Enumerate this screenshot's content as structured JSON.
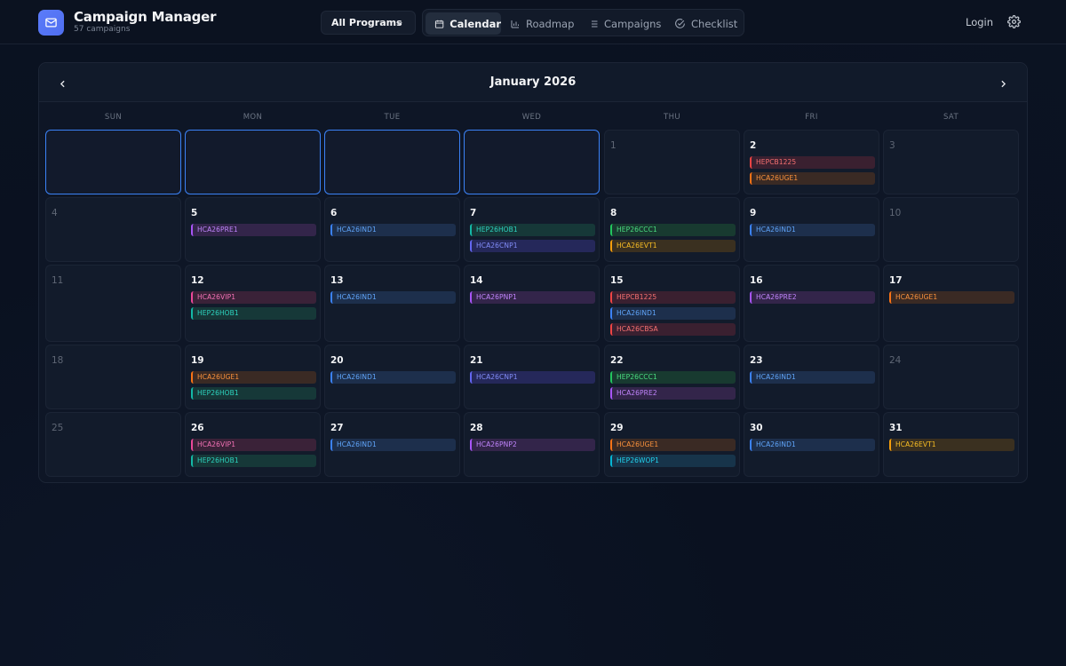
{
  "app": {
    "title": "Campaign Manager",
    "subtitle": "57 campaigns"
  },
  "program_select": {
    "value": "All Programs"
  },
  "nav": {
    "tabs": [
      {
        "label": "Calendar",
        "icon": "calendar-icon",
        "active": true
      },
      {
        "label": "Roadmap",
        "icon": "bar-chart-icon",
        "active": false
      },
      {
        "label": "Campaigns",
        "icon": "list-icon",
        "active": false
      },
      {
        "label": "Checklist",
        "icon": "check-circle-icon",
        "active": false
      }
    ]
  },
  "header": {
    "login_label": "Login"
  },
  "calendar": {
    "month_label": "January 2026",
    "weekdays": [
      "SUN",
      "MON",
      "TUE",
      "WED",
      "THU",
      "FRI",
      "SAT"
    ],
    "days": [
      {
        "day": "1",
        "events": []
      },
      {
        "day": "2",
        "events": [
          {
            "code": "HEPCB1225",
            "color": "red"
          },
          {
            "code": "HCA26UGE1",
            "color": "orange"
          }
        ]
      },
      {
        "day": "3",
        "events": []
      },
      {
        "day": "4",
        "events": []
      },
      {
        "day": "5",
        "events": [
          {
            "code": "HCA26PRE1",
            "color": "purple"
          }
        ]
      },
      {
        "day": "6",
        "events": [
          {
            "code": "HCA26IND1",
            "color": "blue"
          }
        ]
      },
      {
        "day": "7",
        "events": [
          {
            "code": "HEP26HOB1",
            "color": "teal"
          },
          {
            "code": "HCA26CNP1",
            "color": "indigo"
          }
        ]
      },
      {
        "day": "8",
        "events": [
          {
            "code": "HEP26CCC1",
            "color": "green"
          },
          {
            "code": "HCA26EVT1",
            "color": "amber"
          }
        ]
      },
      {
        "day": "9",
        "events": [
          {
            "code": "HCA26IND1",
            "color": "blue"
          }
        ]
      },
      {
        "day": "10",
        "events": []
      },
      {
        "day": "11",
        "events": []
      },
      {
        "day": "12",
        "events": [
          {
            "code": "HCA26VIP1",
            "color": "pink"
          },
          {
            "code": "HEP26HOB1",
            "color": "teal"
          }
        ]
      },
      {
        "day": "13",
        "events": [
          {
            "code": "HCA26IND1",
            "color": "blue"
          }
        ]
      },
      {
        "day": "14",
        "events": [
          {
            "code": "HCA26PNP1",
            "color": "purple"
          }
        ]
      },
      {
        "day": "15",
        "events": [
          {
            "code": "HEPCB1225",
            "color": "red"
          },
          {
            "code": "HCA26IND1",
            "color": "blue"
          },
          {
            "code": "HCA26CBSA",
            "color": "red"
          }
        ]
      },
      {
        "day": "16",
        "events": [
          {
            "code": "HCA26PRE2",
            "color": "purple"
          }
        ]
      },
      {
        "day": "17",
        "events": [
          {
            "code": "HCA26UGE1",
            "color": "orange"
          }
        ]
      },
      {
        "day": "18",
        "events": []
      },
      {
        "day": "19",
        "events": [
          {
            "code": "HCA26UGE1",
            "color": "orange"
          },
          {
            "code": "HEP26HOB1",
            "color": "teal"
          }
        ]
      },
      {
        "day": "20",
        "events": [
          {
            "code": "HCA26IND1",
            "color": "blue"
          }
        ]
      },
      {
        "day": "21",
        "events": [
          {
            "code": "HCA26CNP1",
            "color": "indigo"
          }
        ]
      },
      {
        "day": "22",
        "events": [
          {
            "code": "HEP26CCC1",
            "color": "green"
          },
          {
            "code": "HCA26PRE2",
            "color": "purple"
          }
        ]
      },
      {
        "day": "23",
        "events": [
          {
            "code": "HCA26IND1",
            "color": "blue"
          }
        ]
      },
      {
        "day": "24",
        "events": []
      },
      {
        "day": "25",
        "events": []
      },
      {
        "day": "26",
        "events": [
          {
            "code": "HCA26VIP1",
            "color": "pink"
          },
          {
            "code": "HEP26HOB1",
            "color": "teal"
          }
        ]
      },
      {
        "day": "27",
        "events": [
          {
            "code": "HCA26IND1",
            "color": "blue"
          }
        ]
      },
      {
        "day": "28",
        "events": [
          {
            "code": "HCA26PNP2",
            "color": "purple"
          }
        ]
      },
      {
        "day": "29",
        "events": [
          {
            "code": "HCA26UGE1",
            "color": "orange"
          },
          {
            "code": "HEP26WOP1",
            "color": "cyan"
          }
        ]
      },
      {
        "day": "30",
        "events": [
          {
            "code": "HCA26IND1",
            "color": "blue"
          }
        ]
      },
      {
        "day": "31",
        "events": [
          {
            "code": "HCA26EVT1",
            "color": "amber"
          }
        ]
      }
    ]
  },
  "colors": {
    "accent": "#3b82f6",
    "brand": "#5b7cfa",
    "background": "#0b1220"
  }
}
